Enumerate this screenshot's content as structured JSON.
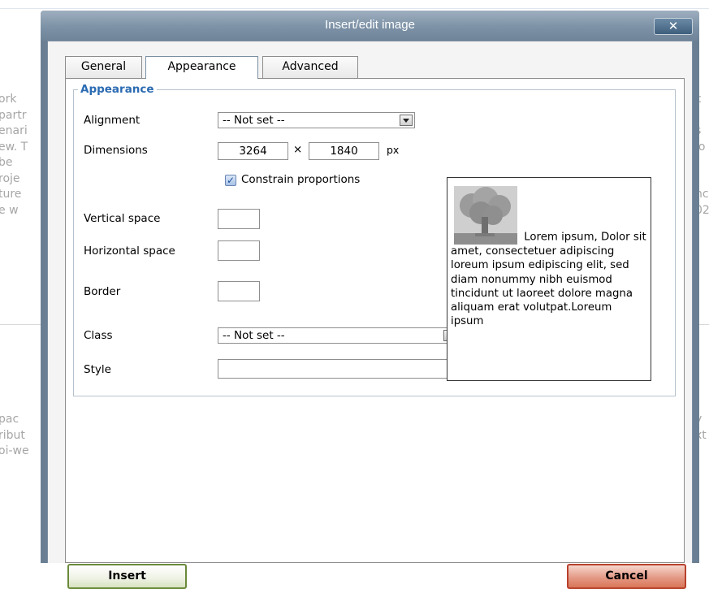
{
  "background": {
    "left_fragments": [
      "ork",
      "partr",
      "enari",
      "ew. T",
      "be",
      "roje",
      "ture",
      "e w"
    ],
    "left_fragments_lower": [
      "pac",
      "ribut",
      "oi-we"
    ],
    "right_fragments": [
      "c",
      "",
      "s",
      "io",
      "",
      "",
      "nc",
      "02"
    ],
    "right_fragments_lower": [
      "y",
      "xt",
      ""
    ]
  },
  "dialog": {
    "title": "Insert/edit image",
    "close_label": "✕",
    "tabs": [
      {
        "label": "General"
      },
      {
        "label": "Appearance"
      },
      {
        "label": "Advanced"
      }
    ],
    "active_tab": "Appearance"
  },
  "appearance": {
    "legend": "Appearance",
    "alignment": {
      "label": "Alignment",
      "value": "-- Not set --"
    },
    "dimensions": {
      "label": "Dimensions",
      "width": "3264",
      "times": "×",
      "height": "1840",
      "unit": "px"
    },
    "constrain": {
      "label": "Constrain proportions",
      "checked": true
    },
    "vertical_space": {
      "label": "Vertical space",
      "value": ""
    },
    "horizontal_space": {
      "label": "Horizontal space",
      "value": ""
    },
    "border": {
      "label": "Border",
      "value": ""
    },
    "class": {
      "label": "Class",
      "value": "-- Not set --"
    },
    "style": {
      "label": "Style",
      "value": ""
    },
    "preview_text": "Lorem ipsum, Dolor sit amet, consectetuer adipiscing loreum ipsum edipiscing elit, sed diam nonummy nibh euismod tincidunt ut laoreet dolore magna aliquam erat volutpat.Loreum ipsum"
  },
  "buttons": {
    "insert": "Insert",
    "cancel": "Cancel"
  },
  "colors": {
    "legend": "#2b6bb2",
    "titlebar": "#7d92a6",
    "insert_border": "#6a8a3a",
    "cancel_fill": "#e49a86"
  }
}
